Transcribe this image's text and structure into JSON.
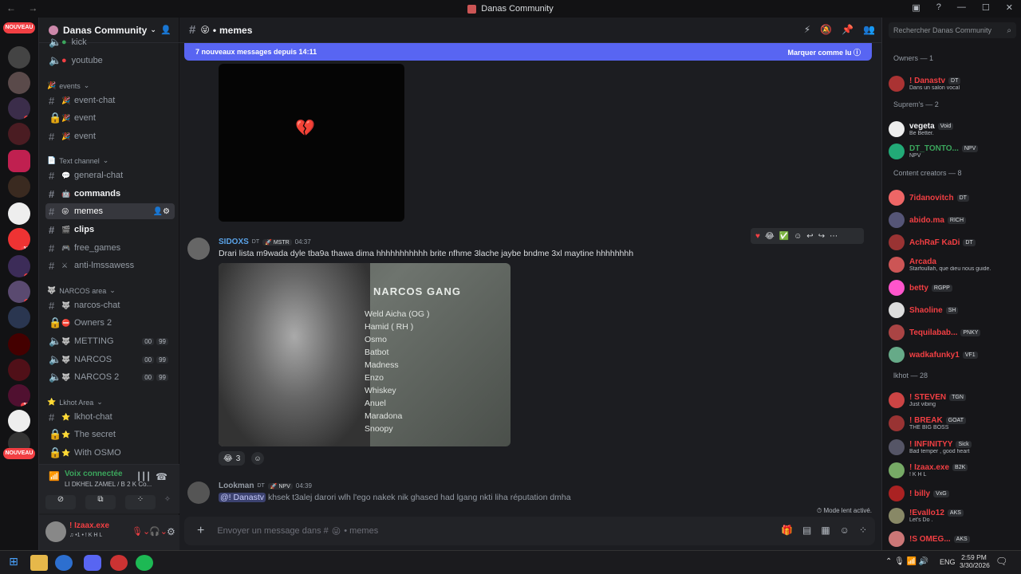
{
  "window": {
    "title": "Danas Community"
  },
  "server": {
    "name": "Danas Community"
  },
  "guilds": {
    "new_badge": "NOUVEAU",
    "badges": [
      "1",
      "17",
      "4",
      "1",
      "16"
    ]
  },
  "sidebar": {
    "items": [
      {
        "label": "kick",
        "type": "text"
      },
      {
        "label": "youtube",
        "type": "text"
      },
      {
        "label": "events",
        "type": "category"
      },
      {
        "label": "event-chat",
        "type": "text"
      },
      {
        "label": "event",
        "type": "text"
      },
      {
        "label": "event",
        "type": "text"
      },
      {
        "label": "Text channel",
        "type": "category"
      },
      {
        "label": "general-chat",
        "type": "text"
      },
      {
        "label": "commands",
        "type": "text"
      },
      {
        "label": "memes",
        "type": "text"
      },
      {
        "label": "clips",
        "type": "text"
      },
      {
        "label": "free_games",
        "type": "text"
      },
      {
        "label": "anti-lmssawess",
        "type": "text"
      },
      {
        "label": "NARCOS area",
        "type": "category"
      },
      {
        "label": "narcos-chat",
        "type": "text"
      },
      {
        "label": "Owners 2",
        "type": "text"
      },
      {
        "label": "METTING",
        "type": "voice"
      },
      {
        "label": "NARCOS",
        "type": "voice"
      },
      {
        "label": "NARCOS 2",
        "type": "voice"
      },
      {
        "label": "Lkhot Area",
        "type": "category"
      },
      {
        "label": "lkhot-chat",
        "type": "text"
      },
      {
        "label": "The secret",
        "type": "text"
      },
      {
        "label": "With OSMO",
        "type": "text"
      }
    ],
    "voice_counts": {
      "a": "00",
      "b": "99"
    }
  },
  "voice": {
    "status": "Voix connectée",
    "channel": "LI DKHEL ZAMEL / B 2 K Co..."
  },
  "user": {
    "name": "! Izaax.exe",
    "status": "♫ •1 • ! K H L"
  },
  "channel": {
    "name": "memes",
    "prefix": "•"
  },
  "banner": {
    "text": "7 nouveaux messages depuis 14:11",
    "action": "Marquer comme lu"
  },
  "messages": [
    {
      "author": "SIDOXS",
      "tag": "DT",
      "badge": "MSTR",
      "time": "04:37",
      "text": "Drari lista m9wada dyle tba9a thawa dima hhhhhhhhhhh brite nfhme 3lache jaybe bndme 3xl maytine hhhhhhhh",
      "image_title": "NARCOS GANG",
      "image_list": [
        "Weld Aicha (OG )",
        "Hamid ( RH )",
        "Osmo",
        "Batbot",
        "Madness",
        "Enzo",
        "Whiskey",
        "Anuel",
        "Maradona",
        "Snoopy"
      ],
      "reaction_count": "3"
    },
    {
      "author": "Lookman",
      "tag": "DT",
      "badge": "NPV",
      "time": "04:39",
      "mention": "@! Danastv",
      "text": "khsek t3alej darori wlh l'ego nakek nik  ghased had lgang nkti liha réputation dmha"
    }
  ],
  "slowmode": "Mode lent activé.",
  "composer": {
    "placeholder": "Envoyer un message dans #",
    "channel": "memes"
  },
  "search": {
    "placeholder": "Rechercher Danas Community"
  },
  "member_groups": [
    {
      "title": "Owners — 1",
      "members": [
        {
          "name": "! Danastv",
          "tag": "DT",
          "status": "Dans un salon vocal",
          "color": "#f23f43"
        }
      ]
    },
    {
      "title": "Suprem's — 2",
      "members": [
        {
          "name": "vegeta",
          "tag": "Void",
          "status": "Be Better.",
          "color": "#f2f3f5"
        },
        {
          "name": "DT_TONTO...",
          "tag": "NPV",
          "status": "NPV",
          "color": "#3ba55c"
        }
      ]
    },
    {
      "title": "Content creators — 8",
      "members": [
        {
          "name": "7idanovitch",
          "tag": "DT",
          "status": "",
          "color": "#f23f43"
        },
        {
          "name": "abido.ma",
          "tag": "RICH",
          "status": "",
          "color": "#f23f43"
        },
        {
          "name": "AchRaF KaDi",
          "tag": "DT",
          "status": "",
          "color": "#f23f43"
        },
        {
          "name": "Arcada",
          "tag": "",
          "status": "Starfoullah, que dieu nous guide.",
          "color": "#f23f43"
        },
        {
          "name": "betty",
          "tag": "RGPP",
          "status": "",
          "color": "#f23f43"
        },
        {
          "name": "Shaoline",
          "tag": "SH",
          "status": "",
          "color": "#f23f43"
        },
        {
          "name": "Tequilabab...",
          "tag": "PNKY",
          "status": "",
          "color": "#f23f43"
        },
        {
          "name": "wadkafunky1",
          "tag": "VF1",
          "status": "",
          "color": "#f23f43"
        }
      ]
    },
    {
      "title": "lkhot — 28",
      "members": [
        {
          "name": "! STEVEN",
          "tag": "TGN",
          "status": "Just vibing",
          "color": "#f23f43"
        },
        {
          "name": "! BREAK",
          "tag": "GOAT",
          "status": "THE BIG BOSS",
          "color": "#f23f43"
        },
        {
          "name": "! INFINITYY",
          "tag": "Sick",
          "status": "Bad temper , good heart",
          "color": "#f23f43"
        },
        {
          "name": "! Izaax.exe",
          "tag": "B2K",
          "status": "! K H L",
          "color": "#f23f43"
        },
        {
          "name": "! billy",
          "tag": "VxG",
          "status": "",
          "color": "#f23f43"
        },
        {
          "name": "!Evallo12",
          "tag": "AKS",
          "status": "Let's Do .",
          "color": "#f23f43"
        },
        {
          "name": "!S OMEG...",
          "tag": "AKS",
          "status": "",
          "color": "#f23f43"
        }
      ]
    }
  ],
  "taskbar": {
    "lang": "ENG",
    "time": "2:59 PM",
    "date": "3/30/2026"
  }
}
